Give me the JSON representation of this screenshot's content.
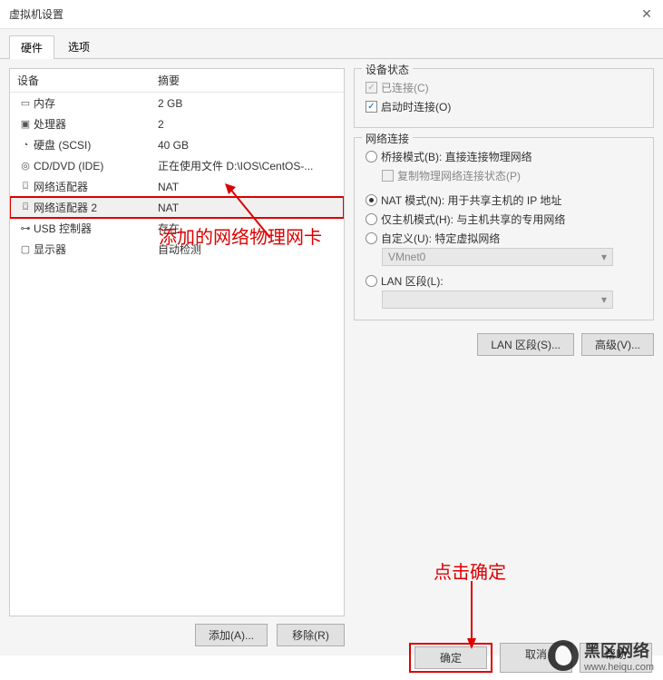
{
  "window": {
    "title": "虚拟机设置"
  },
  "tabs": {
    "hardware": "硬件",
    "options": "选项"
  },
  "list": {
    "header_device": "设备",
    "header_summary": "摘要",
    "items": [
      {
        "icon": "memory-icon",
        "glyph": "▭",
        "name": "内存",
        "summary": "2 GB"
      },
      {
        "icon": "cpu-icon",
        "glyph": "▣",
        "name": "处理器",
        "summary": "2"
      },
      {
        "icon": "disk-icon",
        "glyph": "◔",
        "name": "硬盘 (SCSI)",
        "summary": "40 GB"
      },
      {
        "icon": "cd-icon",
        "glyph": "◎",
        "name": "CD/DVD (IDE)",
        "summary": "正在使用文件 D:\\IOS\\CentOS-..."
      },
      {
        "icon": "nic-icon",
        "glyph": "⌼",
        "name": "网络适配器",
        "summary": "NAT"
      },
      {
        "icon": "nic-icon",
        "glyph": "⌼",
        "name": "网络适配器 2",
        "summary": "NAT"
      },
      {
        "icon": "usb-icon",
        "glyph": "⊶",
        "name": "USB 控制器",
        "summary": "存在"
      },
      {
        "icon": "display-icon",
        "glyph": "▢",
        "name": "显示器",
        "summary": "自动检测"
      }
    ]
  },
  "left_buttons": {
    "add": "添加(A)...",
    "remove": "移除(R)"
  },
  "device_status": {
    "title": "设备状态",
    "connected": "已连接(C)",
    "connect_at_poweron": "启动时连接(O)"
  },
  "network": {
    "title": "网络连接",
    "bridged": "桥接模式(B): 直接连接物理网络",
    "replicate": "复制物理网络连接状态(P)",
    "nat": "NAT 模式(N): 用于共享主机的 IP 地址",
    "hostonly": "仅主机模式(H): 与主机共享的专用网络",
    "custom": "自定义(U): 特定虚拟网络",
    "custom_value": "VMnet0",
    "lan_segment": "LAN 区段(L):",
    "lan_value": ""
  },
  "right_buttons": {
    "lan": "LAN 区段(S)...",
    "advanced": "高级(V)..."
  },
  "bottom_buttons": {
    "ok": "确定",
    "cancel": "取消",
    "help": "帮助"
  },
  "annotations": {
    "label1": "添加的网络物理网卡",
    "label2": "点击确定"
  },
  "watermark": {
    "title": "黑区网络",
    "sub": "www.heiqu.com"
  }
}
